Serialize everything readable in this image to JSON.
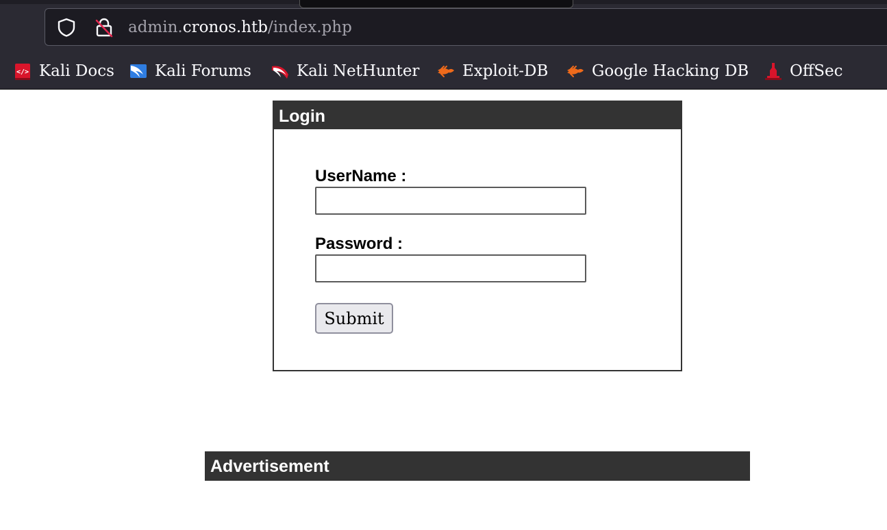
{
  "browser": {
    "url": {
      "prefix": "admin.",
      "host": "cronos.htb",
      "path": "/index.php"
    },
    "urlbar_icons": [
      "shield-icon",
      "lock-slashed-icon"
    ],
    "bookmarks": [
      {
        "label": "Kali Docs",
        "icon": "kali-docs-icon"
      },
      {
        "label": "Kali Forums",
        "icon": "kali-forums-icon"
      },
      {
        "label": "Kali NetHunter",
        "icon": "kali-nethunter-icon"
      },
      {
        "label": "Exploit-DB",
        "icon": "exploit-db-icon"
      },
      {
        "label": "Google Hacking DB",
        "icon": "ghdb-icon"
      },
      {
        "label": "OffSec",
        "icon": "offsec-icon"
      }
    ]
  },
  "login": {
    "title": "Login",
    "username_label": "UserName :",
    "username_value": "",
    "password_label": "Password :",
    "password_value": "",
    "submit_label": "Submit"
  },
  "advertisement": {
    "title": "Advertisement"
  },
  "colors": {
    "chrome_bg": "#2b2a33",
    "panel_header": "#333333",
    "kali_red": "#d9152b",
    "kali_blue": "#2f7de1",
    "exploitdb_orange": "#ee6a1b"
  }
}
